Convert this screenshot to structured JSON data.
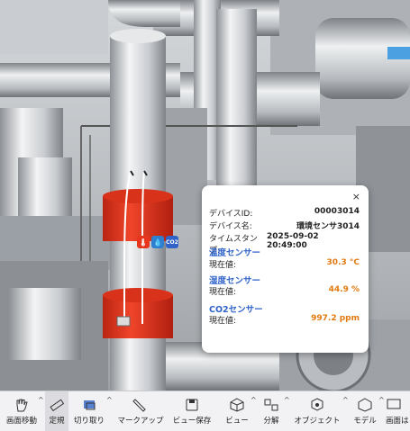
{
  "popup": {
    "close_label": "×",
    "device_id_label": "デバイスID:",
    "device_id_value": "00003014",
    "device_name_label": "デバイス名:",
    "device_name_value": "環境センサ3014",
    "timestamp_label": "タイムスタンプ:",
    "timestamp_value": "2025-09-02 20:49:00",
    "sensors": [
      {
        "title": "温度センサー",
        "label": "現在値:",
        "value": "30.3 °C"
      },
      {
        "title": "湿度センサー",
        "label": "現在値:",
        "value": "44.9 %"
      },
      {
        "title": "CO2センサー",
        "label": "現在値:",
        "value": "997.2 ppm"
      }
    ]
  },
  "badges": {
    "temp_icon": "thermometer-icon",
    "humidity_icon": "droplet-icon",
    "co2_label": "CO2"
  },
  "toolbar": {
    "items": [
      {
        "label": "画面移動",
        "icon": "hand-icon"
      },
      {
        "label": "定規",
        "icon": "ruler-icon"
      },
      {
        "label": "切り取り",
        "icon": "crop-icon"
      },
      {
        "label": "マークアップ",
        "icon": "pen-icon"
      },
      {
        "label": "ビュー保存",
        "icon": "save-view-icon"
      },
      {
        "label": "ビュー",
        "icon": "cube-icon"
      },
      {
        "label": "分解",
        "icon": "explode-icon"
      },
      {
        "label": "オブジェクト",
        "icon": "object-icon"
      },
      {
        "label": "モデル",
        "icon": "model-icon"
      },
      {
        "label": "画面は",
        "icon": "screen-icon"
      }
    ],
    "caret": "^"
  },
  "colors": {
    "accent_blue": "#2f63c8",
    "value_orange": "#e07a10",
    "sensor_red": "#e8361e"
  }
}
